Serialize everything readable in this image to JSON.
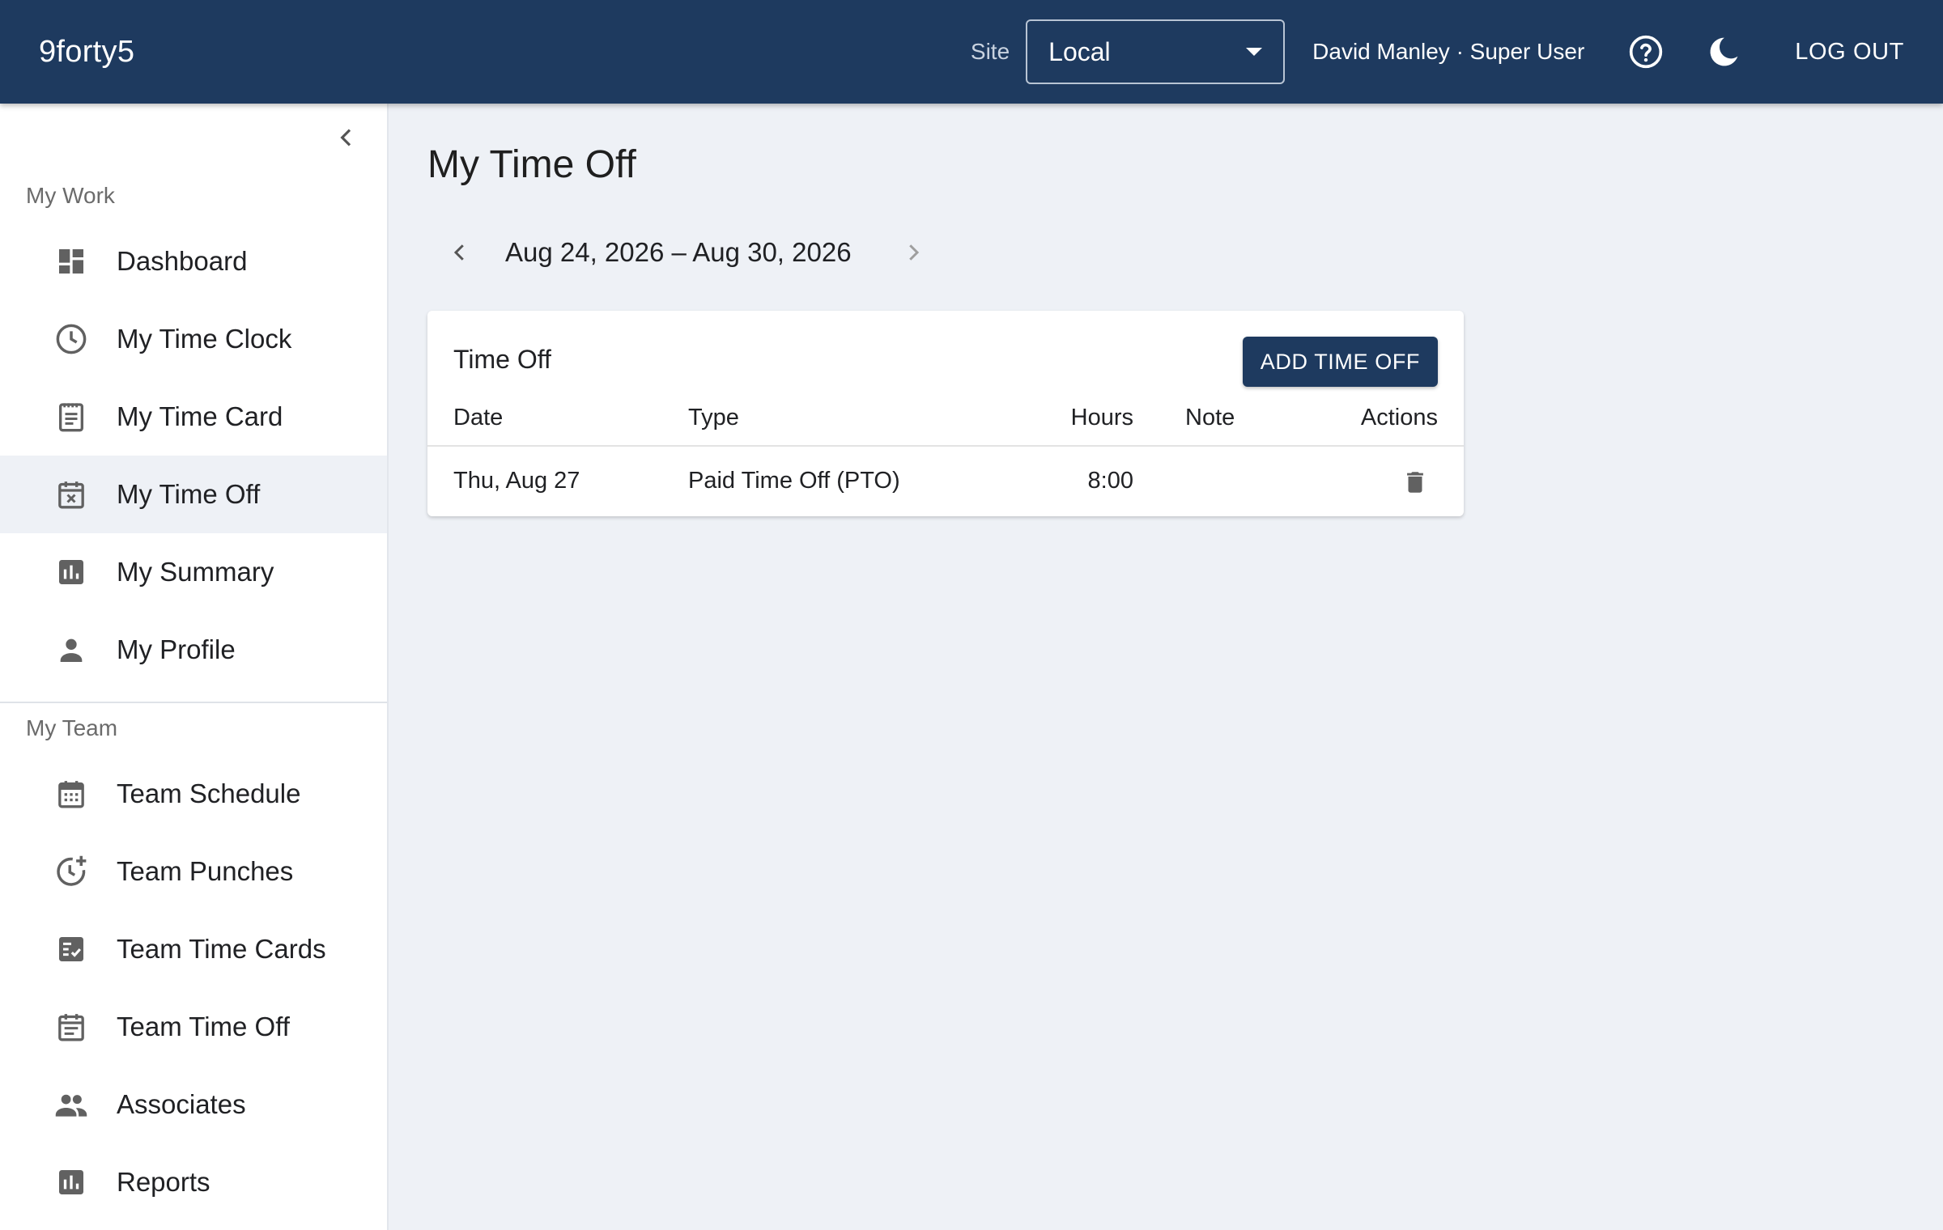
{
  "app": {
    "brand": "9forty5",
    "site_label": "Site",
    "site_value": "Local",
    "user": "David Manley · Super User",
    "logout_label": "LOG OUT"
  },
  "sidebar": {
    "my_work_label": "My Work",
    "my_work_items": [
      {
        "label": "Dashboard",
        "icon": "dashboard-icon"
      },
      {
        "label": "My Time Clock",
        "icon": "clock-icon"
      },
      {
        "label": "My Time Card",
        "icon": "timecard-icon"
      },
      {
        "label": "My Time Off",
        "icon": "calendar-x-icon",
        "active": true
      },
      {
        "label": "My Summary",
        "icon": "bar-chart-icon"
      },
      {
        "label": "My Profile",
        "icon": "person-icon"
      }
    ],
    "my_team_label": "My Team",
    "my_team_items": [
      {
        "label": "Team Schedule",
        "icon": "calendar-grid-icon"
      },
      {
        "label": "Team Punches",
        "icon": "clock-plus-icon"
      },
      {
        "label": "Team Time Cards",
        "icon": "checklist-icon"
      },
      {
        "label": "Team Time Off",
        "icon": "calendar-list-icon"
      },
      {
        "label": "Associates",
        "icon": "people-icon"
      },
      {
        "label": "Reports",
        "icon": "reports-icon"
      }
    ]
  },
  "main": {
    "title": "My Time Off",
    "week_range": "Aug 24, 2026 – Aug 30, 2026",
    "card": {
      "title": "Time Off",
      "add_button": "ADD TIME OFF",
      "columns": [
        "Date",
        "Type",
        "Hours",
        "Note",
        "Actions"
      ],
      "rows": [
        {
          "date": "Thu, Aug 27",
          "type": "Paid Time Off (PTO)",
          "hours": "8:00",
          "note": ""
        }
      ]
    }
  },
  "colors": {
    "primary": "#1e3a5f",
    "background": "#eef1f6",
    "icon_gray": "#616161"
  }
}
